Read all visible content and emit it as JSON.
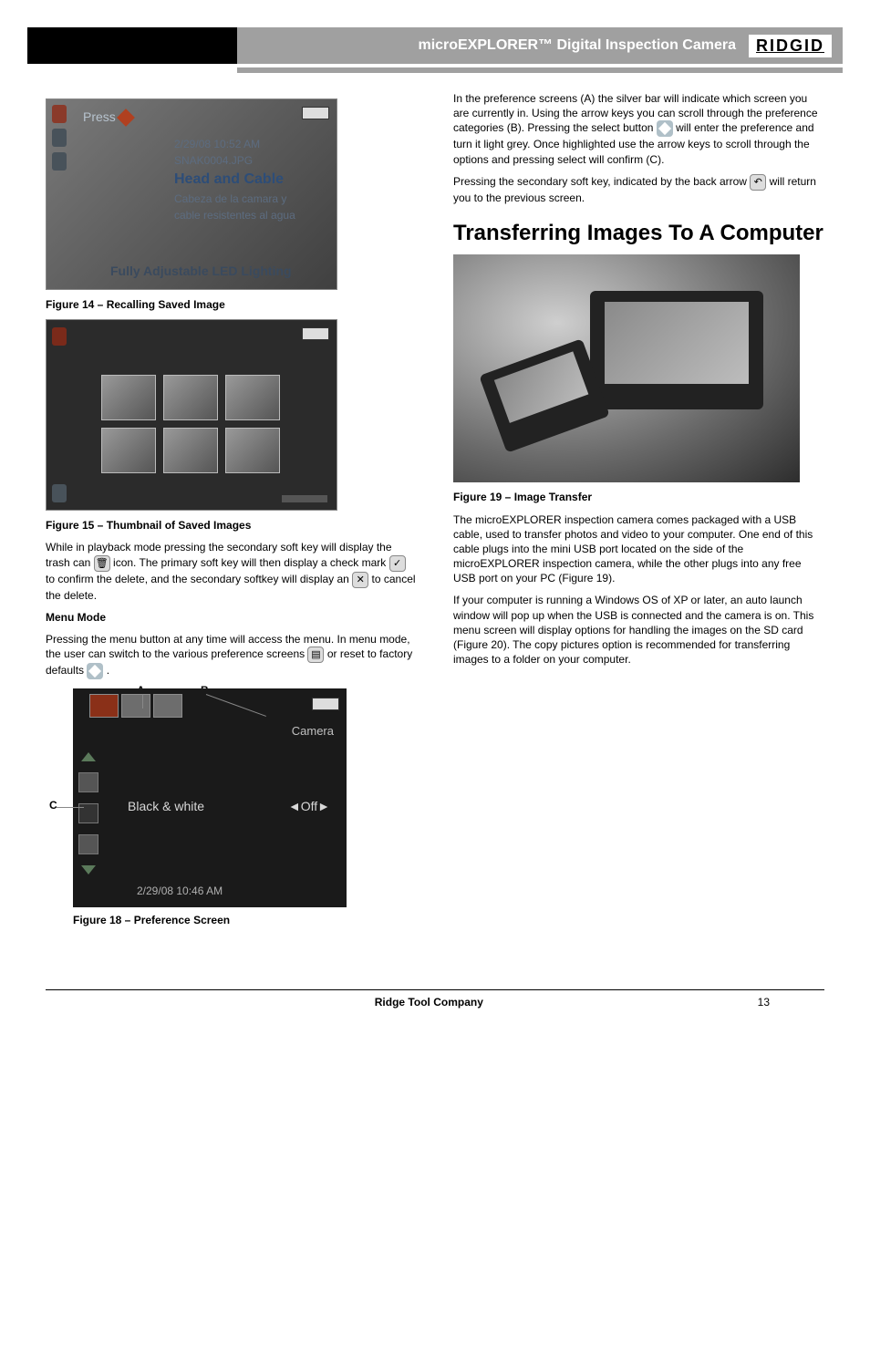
{
  "header": {
    "product": "microEXPLORER™ Digital Inspection Camera",
    "brand": "RIDGID"
  },
  "left_col": {
    "fig14": {
      "caption": "Figure 14 – Recalling Saved Image",
      "timestamp": "2/29/08 10:52 AM",
      "filename": "SNAK0004.JPG",
      "line_head": "Head and Cable",
      "line_es": "Cabeza de la camara y",
      "line_es2": "cable resistentes al agua",
      "footer": "Fully Adjustable LED Lighting"
    },
    "fig15": {
      "caption": "Figure 15 – Thumbnail of Saved Images"
    },
    "p_delete1": "While in playback mode pressing the secondary soft key will display the trash can ",
    "p_delete1b": " icon. The primary soft key will then display a check mark ",
    "p_delete1c": " to confirm the delete, and the secondary softkey will display an ",
    "p_delete1d": " to cancel the delete.",
    "menu_heading": "Menu Mode",
    "p_menu1": "Pressing the menu button at any time will access the menu. In menu mode, the user can switch to the various preference screens ",
    "p_menu1b": " or reset to factory defaults ",
    "p_menu1c": ".",
    "fig18": {
      "camera": "Camera",
      "bw": "Black & white",
      "off": "◄Off►",
      "time": "2/29/08 10:46 AM",
      "caption": "Figure 18 – Preference Screen",
      "label_a": "A",
      "label_b": "B",
      "label_c": "C"
    }
  },
  "right_col": {
    "p1": "In the preference screens (A) the silver bar will indicate which screen you are currently in. Using the arrow keys you can scroll through the preference categories (B). Pressing the select button ",
    "p1b": " will enter the preference and turn it light grey. Once highlighted use the arrow keys to scroll through the options and pressing select will confirm (C).",
    "p2": "Pressing the secondary soft key, indicated by the back arrow ",
    "p2b": " will return you to the previous screen.",
    "transfer_heading": "Transferring Images To A Computer",
    "fig19_caption": "Figure 19 – Image Transfer",
    "p3": "The microEXPLORER inspection camera comes packaged with a USB cable, used to transfer photos and video to your computer. One end of this cable plugs into the mini USB port located on the side of the microEXPLORER inspection camera, while the other plugs into any free USB port on your PC (Figure 19).",
    "p4": "If your computer is running a Windows OS of XP or later, an auto launch window will pop up when the USB is connected and the camera is on. This menu screen will display options for handling the images on the SD card (Figure 20). The copy pictures option is recommended for transferring images to a folder on your computer."
  },
  "footer": {
    "company": "Ridge Tool Company",
    "page": "13"
  }
}
